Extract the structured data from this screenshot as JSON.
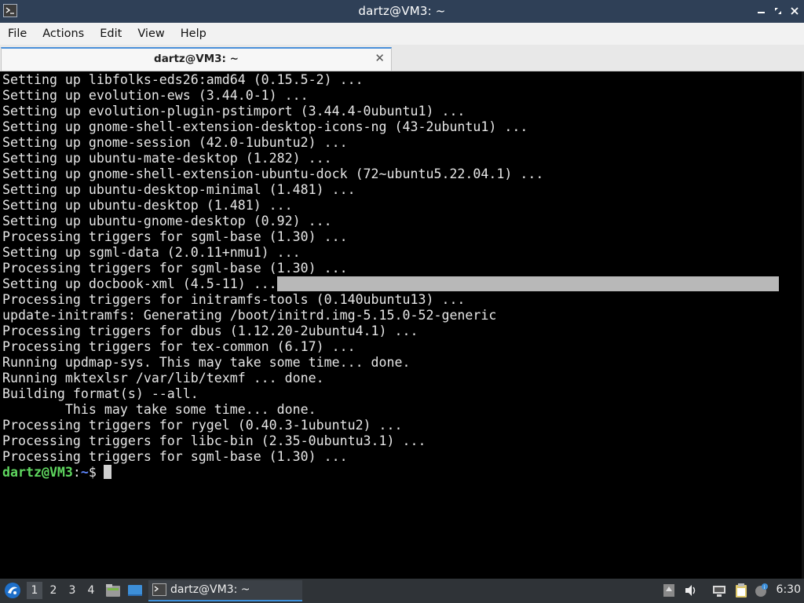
{
  "window": {
    "title": "dartz@VM3: ~",
    "controls": [
      "minimize",
      "maximize",
      "close"
    ]
  },
  "menubar": {
    "items": [
      "File",
      "Actions",
      "Edit",
      "View",
      "Help"
    ]
  },
  "tabs": [
    {
      "label": "dartz@VM3: ~"
    }
  ],
  "terminal": {
    "lines": [
      "Setting up libfolks-eds26:amd64 (0.15.5-2) ...",
      "Setting up evolution-ews (3.44.0-1) ...",
      "Setting up evolution-plugin-pstimport (3.44.4-0ubuntu1) ...",
      "Setting up gnome-shell-extension-desktop-icons-ng (43-2ubuntu1) ...",
      "Setting up gnome-session (42.0-1ubuntu2) ...",
      "Setting up ubuntu-mate-desktop (1.282) ...",
      "Setting up gnome-shell-extension-ubuntu-dock (72~ubuntu5.22.04.1) ...",
      "Setting up ubuntu-desktop-minimal (1.481) ...",
      "Setting up ubuntu-desktop (1.481) ...",
      "Setting up ubuntu-gnome-desktop (0.92) ...",
      "Processing triggers for sgml-base (1.30) ...",
      "Setting up sgml-data (2.0.11+nmu1) ...",
      "Processing triggers for sgml-base (1.30) ...",
      "Setting up docbook-xml (4.5-11) ...",
      "Processing triggers for initramfs-tools (0.140ubuntu13) ...",
      "update-initramfs: Generating /boot/initrd.img-5.15.0-52-generic",
      "Processing triggers for dbus (1.12.20-2ubuntu4.1) ...",
      "Processing triggers for tex-common (6.17) ...",
      "Running updmap-sys. This may take some time... done.",
      "Running mktexlsr /var/lib/texmf ... done.",
      "Building format(s) --all.",
      "        This may take some time... done.",
      "Processing triggers for rygel (0.40.3-1ubuntu2) ...",
      "Processing triggers for libc-bin (2.35-0ubuntu3.1) ...",
      "Processing triggers for sgml-base (1.30) ..."
    ],
    "prompt": {
      "user_host": "dartz@VM3",
      "separator": ":",
      "path": "~",
      "symbol": "$"
    }
  },
  "taskbar": {
    "workspaces": [
      "1",
      "2",
      "3",
      "4"
    ],
    "active_workspace": "1",
    "task_label": "dartz@VM3: ~",
    "clock": "6:30"
  },
  "colors": {
    "titlebar_bg": "#2f4057",
    "prompt_user": "#5fd75f",
    "prompt_path": "#5f87ff",
    "taskbar_bg": "#2f3337",
    "task_underline": "#3d8fd8"
  }
}
